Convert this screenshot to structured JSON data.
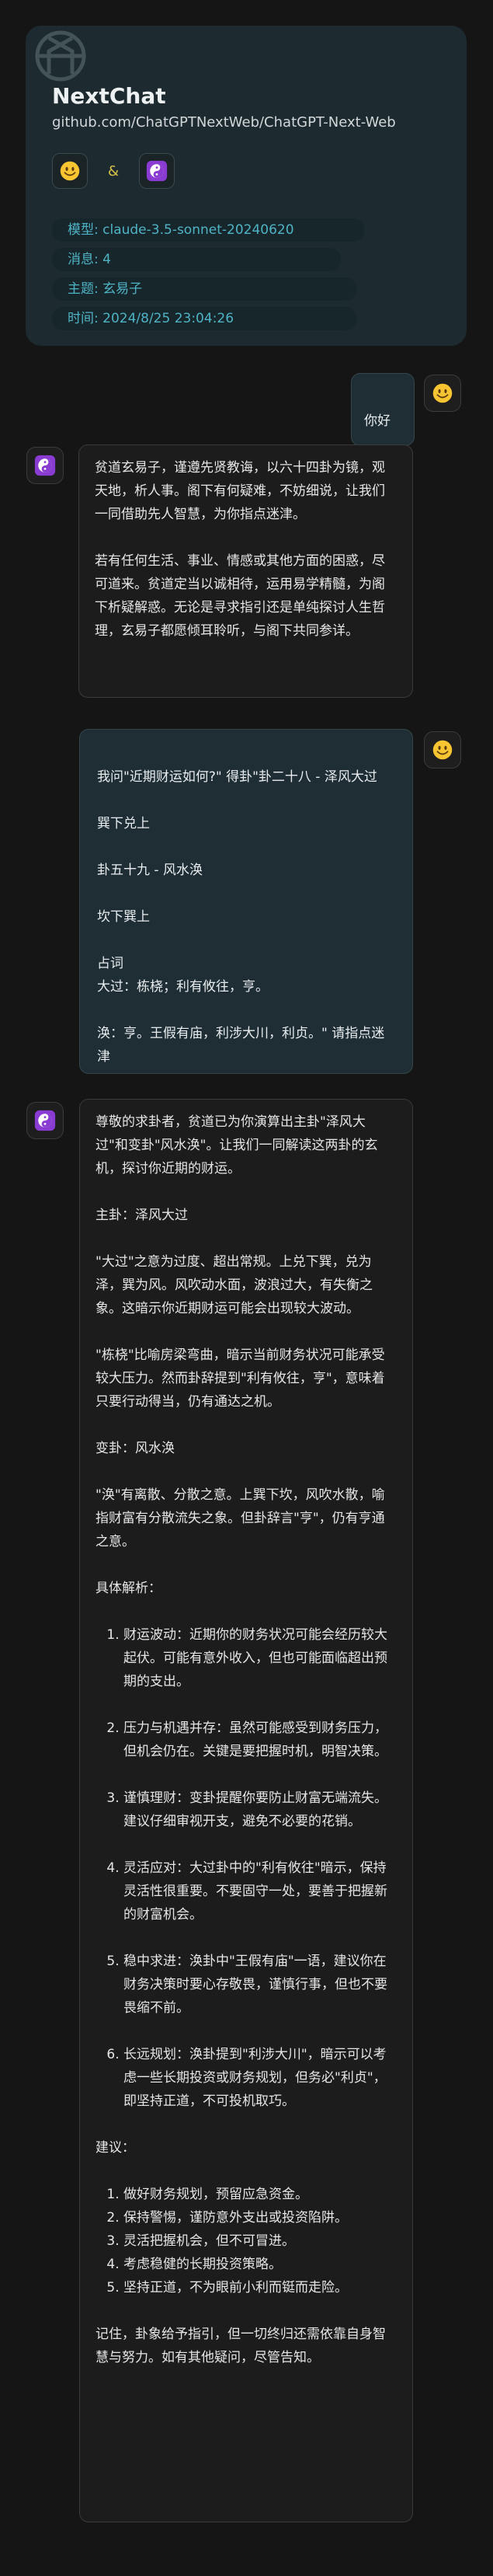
{
  "header": {
    "title": "NextChat",
    "repo": "github.com/ChatGPTNextWeb/ChatGPT-Next-Web",
    "amp": "&",
    "meta": [
      "模型: claude-3.5-sonnet-20240620",
      "消息: 4",
      "主题: 玄易子",
      "时间: 2024/8/25 23:04:26"
    ]
  },
  "messages": {
    "m1": {
      "text": "你好"
    },
    "m2": {
      "paragraphs": [
        "贫道玄易子，谨遵先贤教诲，以六十四卦为镜，观天地，析人事。阁下有何疑难，不妨细说，让我们一同借助先人智慧，为你指点迷津。",
        "若有任何生活、事业、情感或其他方面的困惑，尽可道来。贫道定当以诚相待，运用易学精髓，为阁下析疑解惑。无论是寻求指引还是单纯探讨人生哲理，玄易子都愿倾耳聆听，与阁下共同参详。"
      ]
    },
    "m3": {
      "text": "我问\"近期财运如何?\" 得卦\"卦二十八 - 泽风大过\n\n巽下兑上\n\n卦五十九 - 风水涣\n\n坎下巽上\n\n占词\n大过：栋桡；利有攸往，亨。\n\n涣：亨。王假有庙，利涉大川，利贞。\" 请指点迷津"
    },
    "m4": {
      "intro": "尊敬的求卦者，贫道已为你演算出主卦\"泽风大过\"和变卦\"风水涣\"。让我们一同解读这两卦的玄机，探讨你近期的财运。",
      "main_label": "主卦：泽风大过",
      "main_p1": "\"大过\"之意为过度、超出常规。上兑下巽，兑为泽，巽为风。风吹动水面，波浪过大，有失衡之象。这暗示你近期财运可能会出现较大波动。",
      "main_p2": "\"栋桡\"比喻房梁弯曲，暗示当前财务状况可能承受较大压力。然而卦辞提到\"利有攸往，亨\"，意味着只要行动得当，仍有通达之机。",
      "change_label": "变卦：风水涣",
      "change_p1": "\"涣\"有离散、分散之意。上巽下坎，风吹水散，喻指财富有分散流失之象。但卦辞言\"亨\"，仍有亨通之意。",
      "analysis_label": "具体解析：",
      "analysis": [
        "财运波动：近期你的财务状况可能会经历较大起伏。可能有意外收入，但也可能面临超出预期的支出。",
        "压力与机遇并存：虽然可能感受到财务压力，但机会仍在。关键是要把握时机，明智决策。",
        "谨慎理财：变卦提醒你要防止财富无端流失。建议仔细审视开支，避免不必要的花销。",
        "灵活应对：大过卦中的\"利有攸往\"暗示，保持灵活性很重要。不要固守一处，要善于把握新的财富机会。",
        "稳中求进：涣卦中\"王假有庙\"一语，建议你在财务决策时要心存敬畏，谨慎行事，但也不要畏缩不前。",
        "长远规划：涣卦提到\"利涉大川\"，暗示可以考虑一些长期投资或财务规划，但务必\"利贞\"，即坚持正道，不可投机取巧。"
      ],
      "advice_label": "建议：",
      "advice": [
        "做好财务规划，预留应急资金。",
        "保持警惕，谨防意外支出或投资陷阱。",
        "灵活把握机会，但不可冒进。",
        "考虑稳健的长期投资策略。",
        "坚持正道，不为眼前小利而铤而走险。"
      ],
      "closing": "记住，卦象给予指引，但一切终归还需依靠自身智慧与努力。如有其他疑问，尽管告知。"
    }
  },
  "colors": {
    "accent_text": "#4fb3c6",
    "user_bubble": "#1e2e34",
    "bot_bubble": "#1c1c1c"
  },
  "icons": {
    "user_avatar": "smiley-emoji-icon",
    "bot_avatar": "yin-yang-icon",
    "logo": "openai-logo-icon"
  }
}
